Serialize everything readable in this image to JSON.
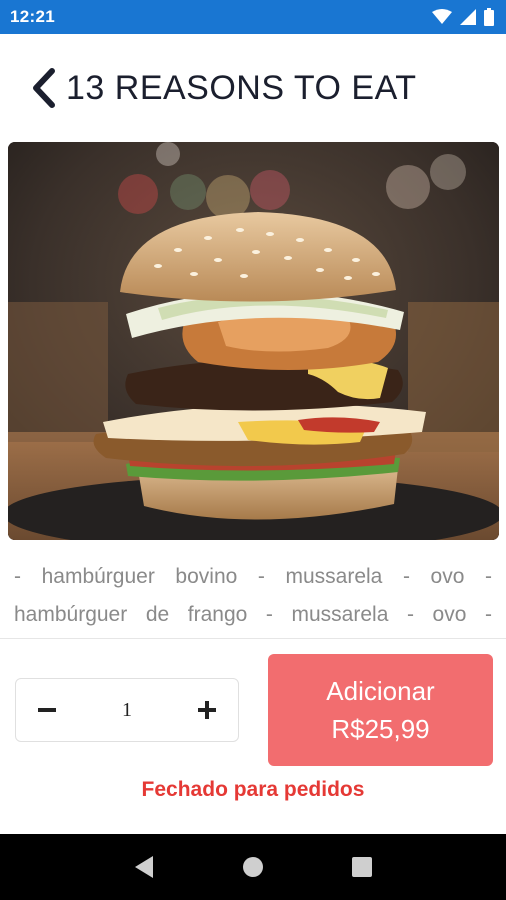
{
  "status_bar": {
    "time": "12:21",
    "icons": [
      "wifi-icon",
      "signal-icon",
      "battery-icon"
    ]
  },
  "header": {
    "back_icon": "chevron-left-icon",
    "title": "13 REASONS TO EAT"
  },
  "product": {
    "image_subject": "burger-photo",
    "ingredients_lines": [
      "- hambúrguer bovino - mussarela - ovo -",
      "hambúrguer de frango - mussarela - ovo -"
    ]
  },
  "order": {
    "decrement_icon": "minus-icon",
    "increment_icon": "plus-icon",
    "quantity": "1",
    "add_label": "Adicionar",
    "price": "R$25,99",
    "closed_notice": "Fechado para pedidos"
  },
  "nav_bar": {
    "icons": [
      "back-triangle-icon",
      "home-circle-icon",
      "recents-square-icon"
    ]
  },
  "colors": {
    "status_bar": "#1976d2",
    "accent_button": "#f26d6f",
    "warning_text": "#e53935",
    "title_text": "#1b1f2e"
  }
}
